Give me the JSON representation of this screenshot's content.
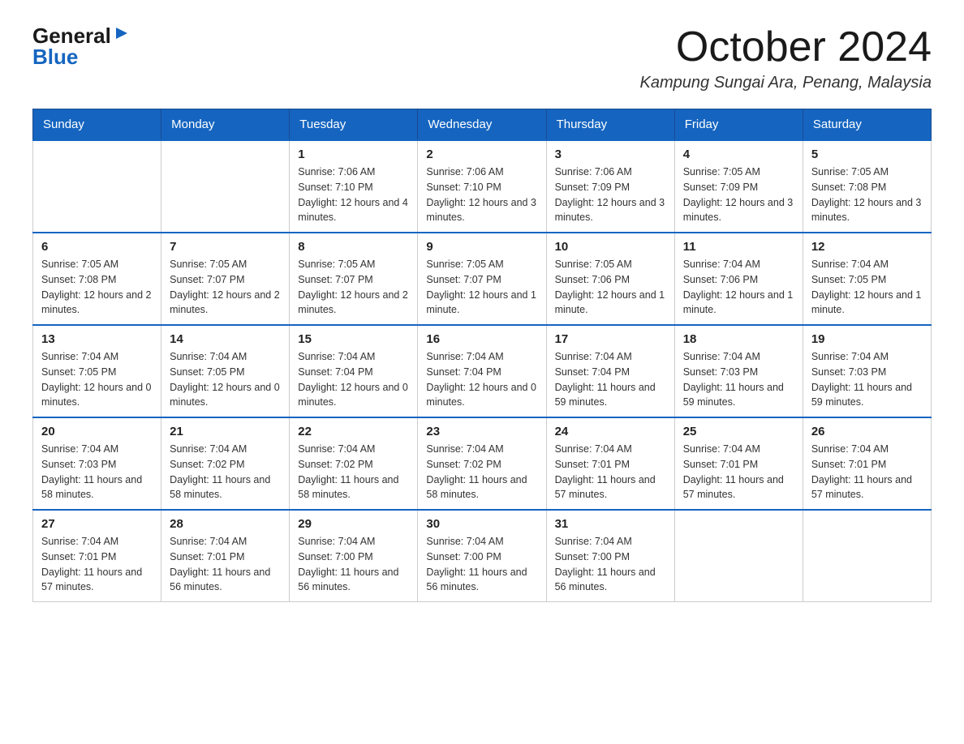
{
  "logo": {
    "general": "General",
    "arrow": "▶",
    "blue": "Blue"
  },
  "title": "October 2024",
  "location": "Kampung Sungai Ara, Penang, Malaysia",
  "days_of_week": [
    "Sunday",
    "Monday",
    "Tuesday",
    "Wednesday",
    "Thursday",
    "Friday",
    "Saturday"
  ],
  "weeks": [
    [
      {
        "day": "",
        "sunrise": "",
        "sunset": "",
        "daylight": ""
      },
      {
        "day": "",
        "sunrise": "",
        "sunset": "",
        "daylight": ""
      },
      {
        "day": "1",
        "sunrise": "Sunrise: 7:06 AM",
        "sunset": "Sunset: 7:10 PM",
        "daylight": "Daylight: 12 hours and 4 minutes."
      },
      {
        "day": "2",
        "sunrise": "Sunrise: 7:06 AM",
        "sunset": "Sunset: 7:10 PM",
        "daylight": "Daylight: 12 hours and 3 minutes."
      },
      {
        "day": "3",
        "sunrise": "Sunrise: 7:06 AM",
        "sunset": "Sunset: 7:09 PM",
        "daylight": "Daylight: 12 hours and 3 minutes."
      },
      {
        "day": "4",
        "sunrise": "Sunrise: 7:05 AM",
        "sunset": "Sunset: 7:09 PM",
        "daylight": "Daylight: 12 hours and 3 minutes."
      },
      {
        "day": "5",
        "sunrise": "Sunrise: 7:05 AM",
        "sunset": "Sunset: 7:08 PM",
        "daylight": "Daylight: 12 hours and 3 minutes."
      }
    ],
    [
      {
        "day": "6",
        "sunrise": "Sunrise: 7:05 AM",
        "sunset": "Sunset: 7:08 PM",
        "daylight": "Daylight: 12 hours and 2 minutes."
      },
      {
        "day": "7",
        "sunrise": "Sunrise: 7:05 AM",
        "sunset": "Sunset: 7:07 PM",
        "daylight": "Daylight: 12 hours and 2 minutes."
      },
      {
        "day": "8",
        "sunrise": "Sunrise: 7:05 AM",
        "sunset": "Sunset: 7:07 PM",
        "daylight": "Daylight: 12 hours and 2 minutes."
      },
      {
        "day": "9",
        "sunrise": "Sunrise: 7:05 AM",
        "sunset": "Sunset: 7:07 PM",
        "daylight": "Daylight: 12 hours and 1 minute."
      },
      {
        "day": "10",
        "sunrise": "Sunrise: 7:05 AM",
        "sunset": "Sunset: 7:06 PM",
        "daylight": "Daylight: 12 hours and 1 minute."
      },
      {
        "day": "11",
        "sunrise": "Sunrise: 7:04 AM",
        "sunset": "Sunset: 7:06 PM",
        "daylight": "Daylight: 12 hours and 1 minute."
      },
      {
        "day": "12",
        "sunrise": "Sunrise: 7:04 AM",
        "sunset": "Sunset: 7:05 PM",
        "daylight": "Daylight: 12 hours and 1 minute."
      }
    ],
    [
      {
        "day": "13",
        "sunrise": "Sunrise: 7:04 AM",
        "sunset": "Sunset: 7:05 PM",
        "daylight": "Daylight: 12 hours and 0 minutes."
      },
      {
        "day": "14",
        "sunrise": "Sunrise: 7:04 AM",
        "sunset": "Sunset: 7:05 PM",
        "daylight": "Daylight: 12 hours and 0 minutes."
      },
      {
        "day": "15",
        "sunrise": "Sunrise: 7:04 AM",
        "sunset": "Sunset: 7:04 PM",
        "daylight": "Daylight: 12 hours and 0 minutes."
      },
      {
        "day": "16",
        "sunrise": "Sunrise: 7:04 AM",
        "sunset": "Sunset: 7:04 PM",
        "daylight": "Daylight: 12 hours and 0 minutes."
      },
      {
        "day": "17",
        "sunrise": "Sunrise: 7:04 AM",
        "sunset": "Sunset: 7:04 PM",
        "daylight": "Daylight: 11 hours and 59 minutes."
      },
      {
        "day": "18",
        "sunrise": "Sunrise: 7:04 AM",
        "sunset": "Sunset: 7:03 PM",
        "daylight": "Daylight: 11 hours and 59 minutes."
      },
      {
        "day": "19",
        "sunrise": "Sunrise: 7:04 AM",
        "sunset": "Sunset: 7:03 PM",
        "daylight": "Daylight: 11 hours and 59 minutes."
      }
    ],
    [
      {
        "day": "20",
        "sunrise": "Sunrise: 7:04 AM",
        "sunset": "Sunset: 7:03 PM",
        "daylight": "Daylight: 11 hours and 58 minutes."
      },
      {
        "day": "21",
        "sunrise": "Sunrise: 7:04 AM",
        "sunset": "Sunset: 7:02 PM",
        "daylight": "Daylight: 11 hours and 58 minutes."
      },
      {
        "day": "22",
        "sunrise": "Sunrise: 7:04 AM",
        "sunset": "Sunset: 7:02 PM",
        "daylight": "Daylight: 11 hours and 58 minutes."
      },
      {
        "day": "23",
        "sunrise": "Sunrise: 7:04 AM",
        "sunset": "Sunset: 7:02 PM",
        "daylight": "Daylight: 11 hours and 58 minutes."
      },
      {
        "day": "24",
        "sunrise": "Sunrise: 7:04 AM",
        "sunset": "Sunset: 7:01 PM",
        "daylight": "Daylight: 11 hours and 57 minutes."
      },
      {
        "day": "25",
        "sunrise": "Sunrise: 7:04 AM",
        "sunset": "Sunset: 7:01 PM",
        "daylight": "Daylight: 11 hours and 57 minutes."
      },
      {
        "day": "26",
        "sunrise": "Sunrise: 7:04 AM",
        "sunset": "Sunset: 7:01 PM",
        "daylight": "Daylight: 11 hours and 57 minutes."
      }
    ],
    [
      {
        "day": "27",
        "sunrise": "Sunrise: 7:04 AM",
        "sunset": "Sunset: 7:01 PM",
        "daylight": "Daylight: 11 hours and 57 minutes."
      },
      {
        "day": "28",
        "sunrise": "Sunrise: 7:04 AM",
        "sunset": "Sunset: 7:01 PM",
        "daylight": "Daylight: 11 hours and 56 minutes."
      },
      {
        "day": "29",
        "sunrise": "Sunrise: 7:04 AM",
        "sunset": "Sunset: 7:00 PM",
        "daylight": "Daylight: 11 hours and 56 minutes."
      },
      {
        "day": "30",
        "sunrise": "Sunrise: 7:04 AM",
        "sunset": "Sunset: 7:00 PM",
        "daylight": "Daylight: 11 hours and 56 minutes."
      },
      {
        "day": "31",
        "sunrise": "Sunrise: 7:04 AM",
        "sunset": "Sunset: 7:00 PM",
        "daylight": "Daylight: 11 hours and 56 minutes."
      },
      {
        "day": "",
        "sunrise": "",
        "sunset": "",
        "daylight": ""
      },
      {
        "day": "",
        "sunrise": "",
        "sunset": "",
        "daylight": ""
      }
    ]
  ]
}
